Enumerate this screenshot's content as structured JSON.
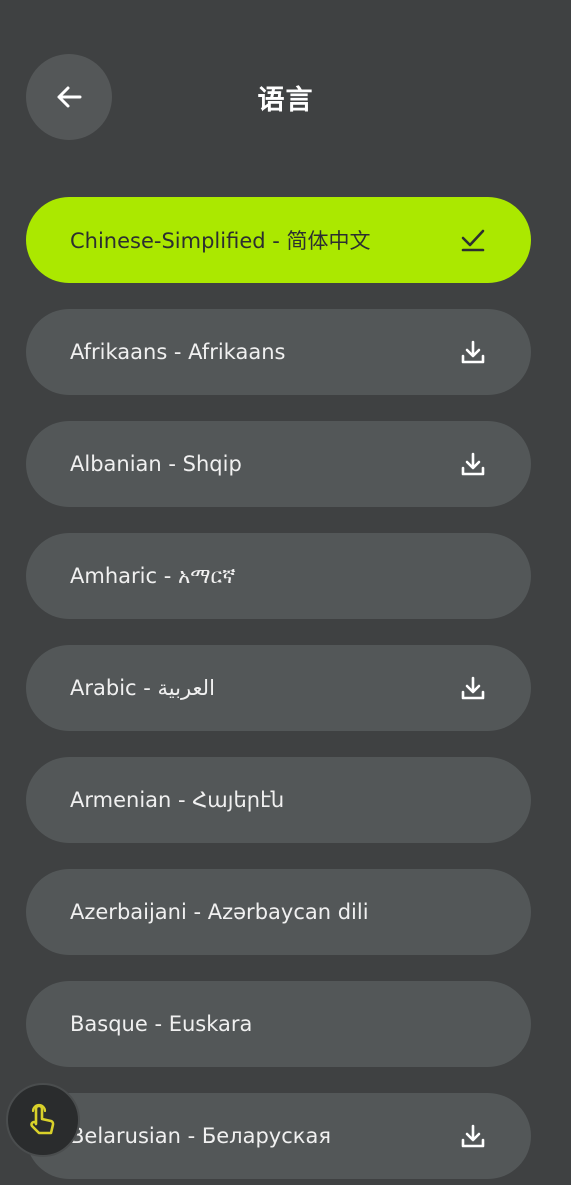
{
  "header": {
    "title": "语言",
    "back_icon": "arrow-left-icon"
  },
  "colors": {
    "background": "#3f4142",
    "item_background": "#535758",
    "selected_background": "#abe800",
    "floating_accent": "#d9d12a"
  },
  "languages": [
    {
      "label": "Chinese-Simplified - 简体中文",
      "selected": true,
      "action_icon": "check-icon"
    },
    {
      "label": "Afrikaans - Afrikaans",
      "selected": false,
      "action_icon": "download-icon"
    },
    {
      "label": "Albanian - Shqip",
      "selected": false,
      "action_icon": "download-icon"
    },
    {
      "label": "Amharic - አማርኛ",
      "selected": false,
      "action_icon": ""
    },
    {
      "label": "Arabic - العربية",
      "selected": false,
      "action_icon": "download-icon"
    },
    {
      "label": "Armenian - Հայերէն",
      "selected": false,
      "action_icon": ""
    },
    {
      "label": "Azerbaijani - Azərbaycan dili",
      "selected": false,
      "action_icon": ""
    },
    {
      "label": "Basque - Euskara",
      "selected": false,
      "action_icon": ""
    },
    {
      "label": "Belarusian - Беларуская",
      "selected": false,
      "action_icon": "download-icon"
    }
  ],
  "floating_button": {
    "icon": "tap-hand-icon"
  }
}
